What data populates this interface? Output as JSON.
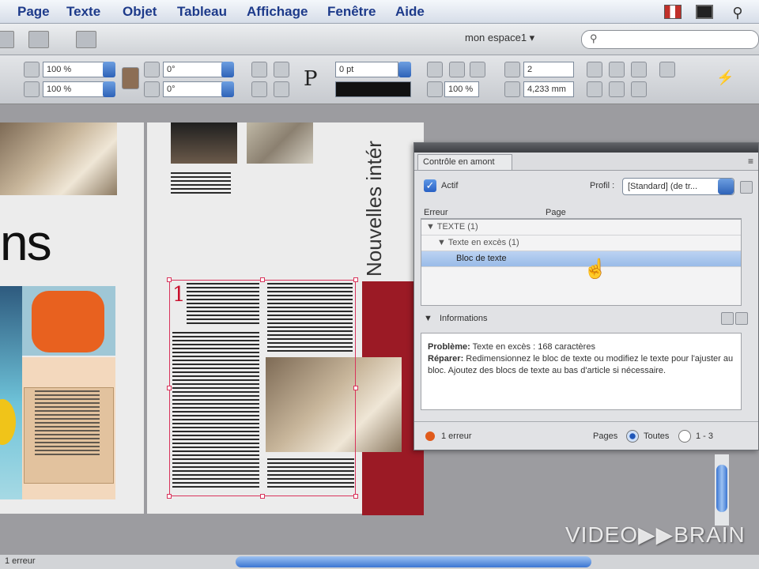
{
  "menubar": {
    "items": [
      "Page",
      "Texte",
      "Objet",
      "Tableau",
      "Affichage",
      "Fenêtre",
      "Aide"
    ]
  },
  "toolbar": {
    "workspace": "mon espace1 ▾",
    "search_placeholder": "⚲"
  },
  "controls": {
    "scale_x": "100 %",
    "scale_y": "100 %",
    "rotate": "0°",
    "shear": "0°",
    "stroke_weight": "0 pt",
    "opacity": "100 %",
    "p_glyph": "P",
    "columns": "2",
    "gutter": "4,233 mm"
  },
  "document": {
    "big_text": "ns",
    "vertical_title": "Nouvelles intér",
    "drop_cap": "1"
  },
  "panel": {
    "tab_title": "Contrôle en amont",
    "active_label": "Actif",
    "profile_label": "Profil :",
    "profile_value": "[Standard] (de tr...",
    "col_error": "Erreur",
    "col_page": "Page",
    "rows": [
      {
        "label": "▼ TEXTE (1)"
      },
      {
        "label": "▼ Texte en excès (1)"
      },
      {
        "label": "Bloc de texte"
      }
    ],
    "info_label": "Informations",
    "problem_label": "Problème:",
    "problem_text": " Texte en excès : 168 caractères",
    "fix_label": "Réparer:",
    "fix_text": " Redimensionnez le bloc de texte ou modifiez le texte pour l'ajuster au bloc. Ajoutez des blocs de texte au bas d'article si nécessaire.",
    "error_count": "1 erreur",
    "pages_label": "Pages",
    "all_label": "Toutes",
    "range_label": "1 - 3"
  },
  "status": {
    "bottom_left": "1 erreur"
  },
  "watermark": "VIDEO▶▶BRAIN",
  "colors": {
    "menu_text": "#1d3a8a",
    "selection": "#d9345c",
    "red_band": "#9b1a25",
    "accent_blue": "#2e62b8"
  }
}
